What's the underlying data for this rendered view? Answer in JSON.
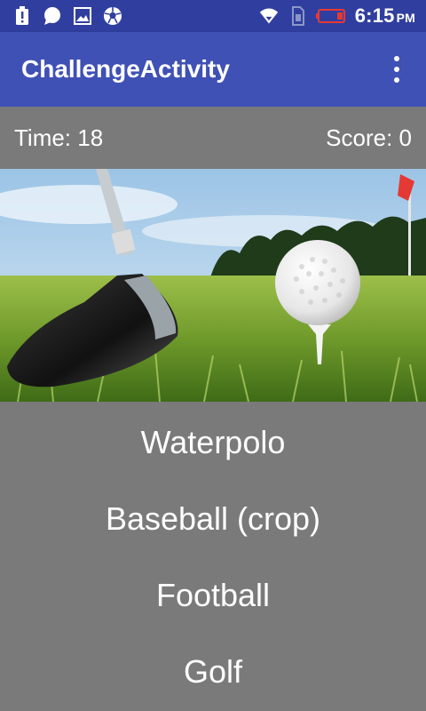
{
  "status_bar": {
    "time": "6:15",
    "ampm": "PM",
    "icons": [
      "alert-icon",
      "chat-bubble-icon",
      "image-icon",
      "soccer-ball-icon",
      "wifi-icon",
      "sim-icon",
      "battery-icon"
    ],
    "battery_color": "#e53935"
  },
  "app_bar": {
    "title": "ChallengeActivity",
    "overflow_icon": "more-vert-icon",
    "color": "#3f51b5"
  },
  "score_bar": {
    "time_label": "Time: 18",
    "score_label": "Score: 0"
  },
  "image": {
    "subject": "golf-club-and-ball-image"
  },
  "answers": [
    "Waterpolo",
    "Baseball (crop)",
    "Football",
    "Golf"
  ]
}
